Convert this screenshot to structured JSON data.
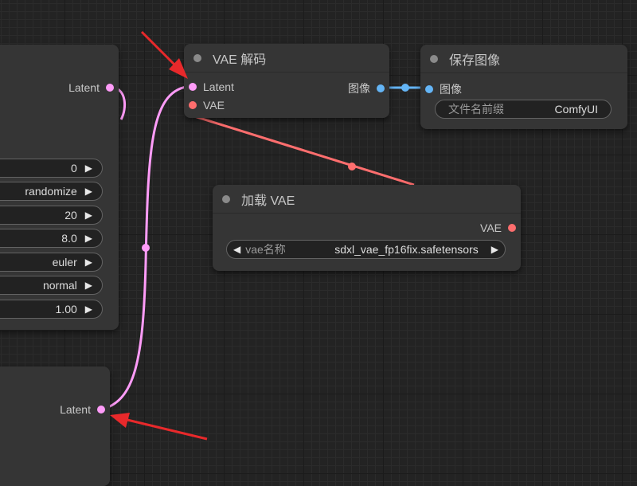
{
  "ksampler": {
    "output_latent": "Latent",
    "widgets": [
      {
        "value": "0"
      },
      {
        "value": "randomize"
      },
      {
        "value": "20"
      },
      {
        "value": "8.0"
      },
      {
        "value": "euler"
      },
      {
        "value": "normal"
      },
      {
        "value": "1.00"
      }
    ]
  },
  "empty_latent": {
    "output_latent": "Latent"
  },
  "vae_decode": {
    "title": "VAE 解码",
    "input_latent": "Latent",
    "input_vae": "VAE",
    "output_image": "图像"
  },
  "save_image": {
    "title": "保存图像",
    "input_image": "图像",
    "filename_prefix_label": "文件名前缀",
    "filename_prefix_value": "ComfyUI"
  },
  "load_vae": {
    "title": "加载 VAE",
    "output_vae": "VAE",
    "vae_name_label": "vae名称",
    "vae_name_value": "sdxl_vae_fp16fix.safetensors"
  },
  "colors": {
    "latent_link": "#ff9cf9",
    "vae_link": "#ff6e6e",
    "image_link": "#64b5f6",
    "annotation_arrow": "#e8292b"
  }
}
